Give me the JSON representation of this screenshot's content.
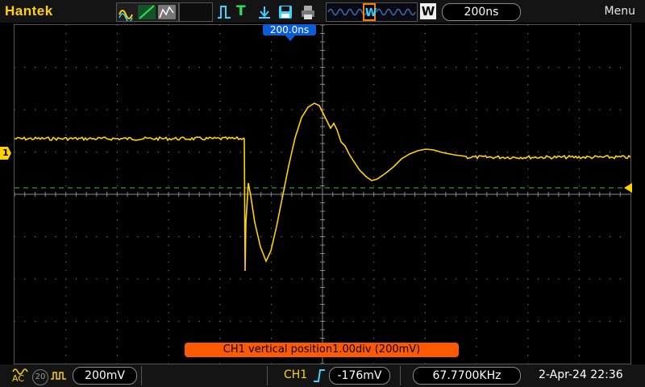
{
  "brand": "Hantek",
  "toolbar": {
    "timebase": "200ns",
    "window_label": "W",
    "run_icon_label": "T",
    "menu": "Menu"
  },
  "screen": {
    "horizontal_position": "200.0ns",
    "channel_marker": "1",
    "status_message": "CH1 vertical position1.00div (200mV)"
  },
  "bottom": {
    "coupling": "AC",
    "bw_limit": "20",
    "ch1_scale": "200mV",
    "trigger_channel": "CH1",
    "trigger_level": "-176mV",
    "frequency": "67.7700KHz",
    "datetime": "2-Apr-24 22:36"
  },
  "colors": {
    "ch1": "#ffd200",
    "status_bg": "#ff5a00",
    "hpos_bg": "#0a5fd8",
    "trigger_line": "#3bbf3b"
  }
}
